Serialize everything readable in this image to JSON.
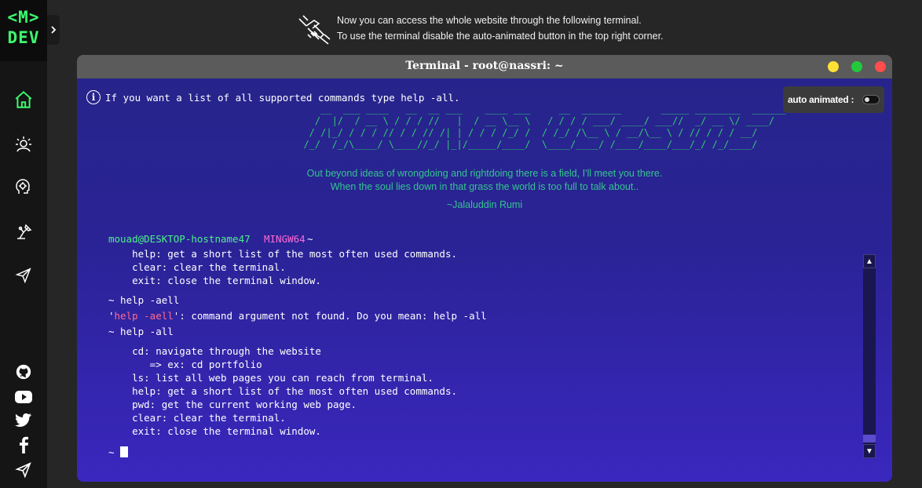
{
  "logo": {
    "line1": "<M>",
    "line2": "DEV"
  },
  "sidebar": {
    "expand_icon": "chevron-right-icon",
    "nav": [
      {
        "name": "home",
        "icon": "home-icon",
        "active": true
      },
      {
        "name": "about",
        "icon": "sun-person-icon"
      },
      {
        "name": "skills",
        "icon": "brain-gear-icon"
      },
      {
        "name": "projects",
        "icon": "desk-lamp-icon"
      },
      {
        "name": "contact",
        "icon": "send-icon"
      }
    ],
    "social": [
      {
        "name": "github",
        "icon": "github-icon"
      },
      {
        "name": "youtube",
        "icon": "youtube-icon"
      },
      {
        "name": "twitter",
        "icon": "twitter-icon"
      },
      {
        "name": "facebook",
        "icon": "facebook-icon"
      },
      {
        "name": "telegram",
        "icon": "telegram-icon"
      }
    ],
    "active_color": "#3cfb6f"
  },
  "notice": {
    "icon": "handshake-icon",
    "line1": "Now you can access the whole website through the following terminal.",
    "line2": "To use the terminal disable the auto-animated button in the top right corner."
  },
  "terminal": {
    "title": "Terminal - root@nassri: ~",
    "window_buttons": [
      {
        "name": "minimize",
        "color": "#ffe135"
      },
      {
        "name": "maximize",
        "color": "#23c93c"
      },
      {
        "name": "close",
        "color": "#ff4d4d"
      }
    ],
    "info_text": "If you want a list of all supported commands type help -all.",
    "auto_animated": {
      "label": "auto animated :",
      "enabled": false
    },
    "ascii_lines": [
      "     __  ___ ____   __  __ ___    ____ ___     __  _______       _____ ________  ______",
      "    /  |/  / __ \\ / / / //   |  / __ \\__ \\   / / / / ___/ ____/ ___//  _/ __ \\/ ____/",
      "   / /|_/ / / / // / / // /| | / / / /_/ /  / /_/ /\\__ \\ / __/\\__ \\ / // / / / __/   ",
      "  /_/  /_/\\____/ \\____//_/ |_|/_____/____/  \\____/____/ /____/____/___/_/ /_/____/  "
    ],
    "quote": {
      "line1": "Out beyond ideas of wrongdoing and rightdoing there is a field, I'll meet you there.",
      "line2": "When the soul lies down in that grass the world is too full to talk about..",
      "author": "~Jalaluddin Rumi"
    },
    "prompt": {
      "user": "mouad@DESKTOP-hostname47",
      "shell": "MINGW64",
      "path": "~"
    },
    "output": {
      "prev": [
        "    help: get a short list of the most often used commands.",
        "    clear: clear the terminal.",
        "    exit: close the terminal window."
      ],
      "cmd1": "~ help -aell",
      "err_q1": "'",
      "err_cmd": "help -aell",
      "err_rest": "': command argument not found. Do you mean: help -all",
      "cmd2": "~ help -all",
      "help": [
        "    cd: navigate through the website",
        "       => ex: cd portfolio",
        "    ls: list all web pages you can reach from terminal.",
        "    help: get a short list of the most often used commands.",
        "    pwd: get the current working web page.",
        "    clear: clear the terminal.",
        "    exit: close the terminal window."
      ],
      "cursor_prompt": "~"
    }
  }
}
